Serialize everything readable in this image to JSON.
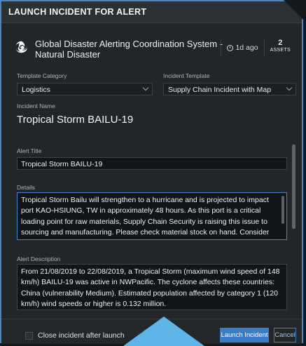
{
  "dialog": {
    "title": "LAUNCH INCIDENT FOR ALERT"
  },
  "source": {
    "icon": "swirl-logo-icon",
    "name": "Global Disaster Alerting Coordination System - Natural Disaster",
    "time": "1d ago",
    "assets_count": "2",
    "assets_label": "ASSETS"
  },
  "template_category": {
    "label": "Template Category",
    "value": "Logistics"
  },
  "incident_template": {
    "label": "Incident Template",
    "value": "Supply Chain Incident with Map"
  },
  "incident_name": {
    "label": "Incident Name",
    "value": "Tropical Storm BAILU-19"
  },
  "alert_title": {
    "label": "Alert Title",
    "value": "Tropical Storm BAILU-19"
  },
  "details": {
    "label": "Details",
    "value": "Tropical Storm Bailu will strengthen to a hurricane and is projected to impact port KAO-HSIUNG, TW in approximately 48 hours. As this port is a critical loading point for raw materials, Supply Chain Security is raising this issue to sourcing and manufacturing. Please check material stock on hand. Consider contingency planning for a port closure. Please acknowledge and advise if you"
  },
  "alert_description": {
    "label": "Alert Description",
    "value": "From 21/08/2019 to 22/08/2019, a Tropical Storm (maximum wind speed of 148 km/h) BAILU-19 was active in NWPacific. The cyclone affects these countries: China (vulnerability Medium). Estimated population affected by category 1 (120 km/h) wind speeds or higher is 0.132 million."
  },
  "footer": {
    "close_after_launch_label": "Close incident after launch",
    "launch_label": "Launch Incident",
    "cancel_label": "Cancel"
  },
  "colors": {
    "accent": "#3b7cc4",
    "border": "#4a86c5",
    "pointer": "#5fb5e8"
  }
}
